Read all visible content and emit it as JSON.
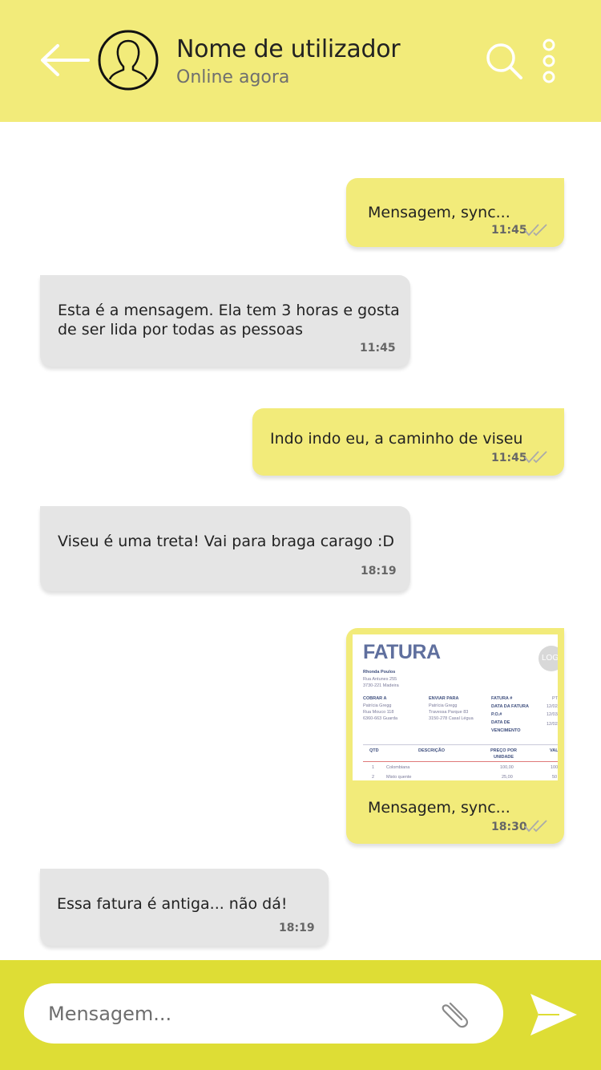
{
  "header": {
    "user_name": "Nome de utilizador",
    "status": "Online agora"
  },
  "messages": [
    {
      "direction": "out",
      "text": "Mensagem, sync...",
      "time": "11:45",
      "read": true
    },
    {
      "direction": "in",
      "text": "Esta é a mensagem. Ela tem 3 horas e gosta de ser lida por todas as pessoas",
      "time": "11:45"
    },
    {
      "direction": "out",
      "text": "Indo indo eu, a caminho de viseu",
      "time": "11:45",
      "read": true
    },
    {
      "direction": "in",
      "text": "Viseu é uma treta! Vai para braga carago :D",
      "time": "18:19"
    },
    {
      "direction": "out",
      "text": "Mensagem, sync...",
      "time": "18:30",
      "read": true,
      "attachment": {
        "title": "FATURA",
        "logo": "LOG",
        "sender": [
          "Rhonda Poulos",
          "Rua Antunes 255",
          "3730-221 Madeira"
        ],
        "bill_to_label": "COBRAR A",
        "bill_to": [
          "Patrícia Gregg",
          "Rua Mouco 118",
          "6360-663 Guarda"
        ],
        "ship_to_label": "ENVIAR PARA",
        "ship_to": [
          "Patrícia Gregg",
          "Travessa Parque 83",
          "3150-278 Casal Légua"
        ],
        "meta_labels": [
          "FATURA #",
          "DATA DA FATURA",
          "P.O.#",
          "DATA DE",
          "VENCIMENTO"
        ],
        "meta_values": [
          "PT",
          "12/02/",
          "12/03/",
          "",
          "12/02/"
        ],
        "columns": [
          "QTD",
          "DESCRIÇÃO",
          "PREÇO POR",
          "UNIDADE",
          "VAL"
        ],
        "rows": [
          {
            "qty": "1",
            "desc": "Colombiana",
            "price": "100,00",
            "val": "100"
          },
          {
            "qty": "2",
            "desc": "Misto quente",
            "price": "25,00",
            "val": "50"
          }
        ]
      }
    },
    {
      "direction": "in",
      "text": "Essa fatura é antiga... não dá!",
      "time": "18:19"
    }
  ],
  "composer": {
    "placeholder": "Mensagem..."
  },
  "icons": {
    "back": "arrow-left-icon",
    "avatar": "user-icon",
    "search": "search-icon",
    "more": "more-vertical-icon",
    "attach": "paperclip-icon",
    "send": "send-icon",
    "read": "double-check-icon"
  },
  "colors": {
    "header": "#f2eb7a",
    "outgoing_bubble": "#f2eb7a",
    "incoming_bubble": "#e5e5e5",
    "bottom_bar": "#dedd35",
    "invoice_title": "#5f6f9e"
  }
}
